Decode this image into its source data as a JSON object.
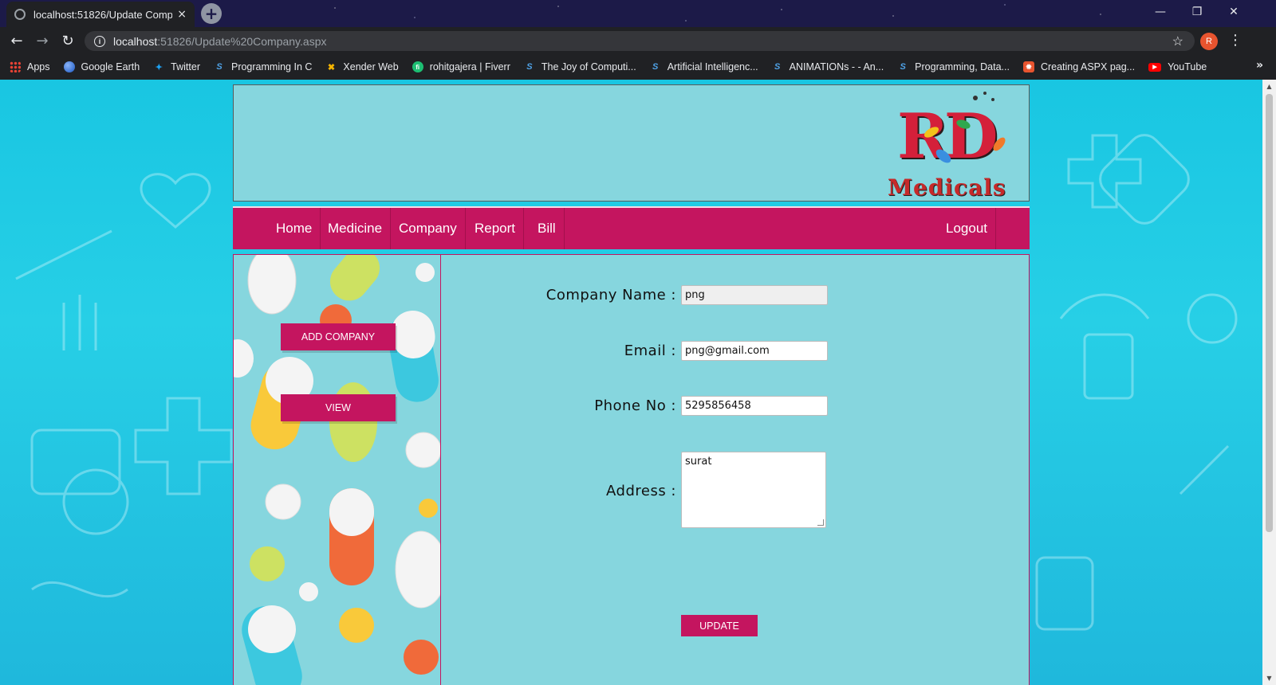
{
  "browser": {
    "tab_title": "localhost:51826/Update Company",
    "tab_close": "×",
    "new_tab": "+",
    "url_host": "localhost",
    "url_path": ":51826/Update%20Company.aspx",
    "profile_initial": "R",
    "window_controls": [
      "—",
      "❐",
      "✕"
    ],
    "bookmarks": [
      {
        "label": "Apps",
        "icon": "apps-grid-icon"
      },
      {
        "label": "Google Earth",
        "icon": "google-earth-icon"
      },
      {
        "label": "Twitter",
        "icon": "twitter-icon"
      },
      {
        "label": "Programming In C",
        "icon": "s-logo-icon"
      },
      {
        "label": "Xender Web",
        "icon": "xender-icon"
      },
      {
        "label": "rohitgajera | Fiverr",
        "icon": "fiverr-icon"
      },
      {
        "label": "The Joy of Computi...",
        "icon": "s-logo-icon"
      },
      {
        "label": "Artificial Intelligenc...",
        "icon": "s-logo-icon"
      },
      {
        "label": "ANIMATIONs - - An...",
        "icon": "s-logo-icon"
      },
      {
        "label": "Programming, Data...",
        "icon": "s-logo-icon"
      },
      {
        "label": "Creating ASPX pag...",
        "icon": "aspx-icon"
      },
      {
        "label": "YouTube",
        "icon": "youtube-icon"
      }
    ],
    "bookmarks_more": "»"
  },
  "logo": {
    "letters": "RD",
    "tagline": "Medicals"
  },
  "menu": {
    "items": [
      "Home",
      "Medicine",
      "Company",
      "Report",
      "Bill"
    ],
    "logout": "Logout"
  },
  "sidebar": {
    "add_company": "ADD COMPANY",
    "view": "VIEW"
  },
  "form": {
    "company_name_label": "Company Name :",
    "company_name_value": "png",
    "email_label": "Email :",
    "email_value": "png@gmail.com",
    "phone_label": "Phone No :",
    "phone_value": "5295856458",
    "address_label": "Address :",
    "address_value": "surat",
    "update_button": "UPDATE"
  },
  "colors": {
    "accent": "#c4155f",
    "panel": "#86d6de",
    "page_bg": "#1fc4e0"
  }
}
